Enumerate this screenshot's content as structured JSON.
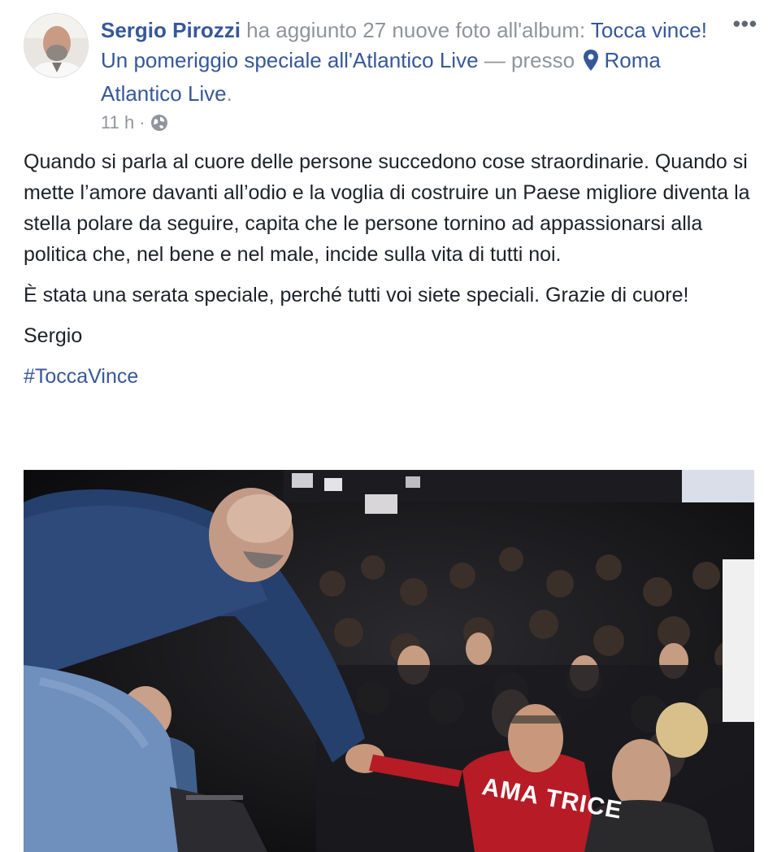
{
  "post": {
    "author": "Sergio Pirozzi",
    "action": "ha aggiunto 27 nuove foto all'album:",
    "album": "Tocca vince! Un pomeriggio speciale all'Atlantico Live",
    "location_prefix": "— presso",
    "location": "Roma Atlantico Live",
    "timestamp": "11 h",
    "privacy_separator": "·",
    "privacy_icon": "globe-icon",
    "more_icon": "ellipsis-icon",
    "more_label": "•••"
  },
  "body": {
    "paragraph_1": "Quando si parla al cuore delle persone succedono cose straordinarie. Quando si mette l’amore davanti all’odio e la voglia di costruire un Paese migliore diventa la stella polare da seguire, capita che le persone tornino ad appassionarsi alla politica che, nel bene e nel male, incide sulla vita di tutti noi.",
    "paragraph_2": "È stata una serata speciale, perché tutti voi siete speciali. Grazie di cuore!",
    "signature": "Sergio",
    "hashtag": "#ToccaVince"
  },
  "photo": {
    "shirt_text": "AMA TRICE"
  },
  "colors": {
    "link": "#365899",
    "meta": "#90949c",
    "text": "#1d2129"
  }
}
